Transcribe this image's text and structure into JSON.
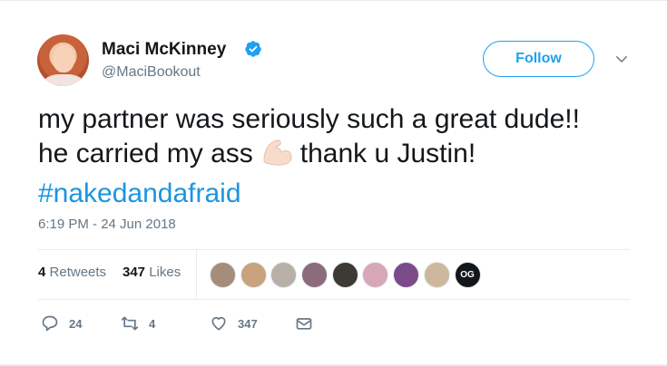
{
  "user": {
    "name": "Maci McKinney",
    "handle": "@MaciBookout",
    "verified": true
  },
  "follow_label": "Follow",
  "tweet": {
    "text_line1": "my partner was seriously such a great dude!!",
    "text_line2_before": "he carried my ass",
    "emoji": "flexed-biceps-emoji",
    "text_line2_after": "thank u Justin!",
    "hashtag": "#nakedandafraid"
  },
  "timestamp": "6:19 PM - 24 Jun 2018",
  "stats": {
    "retweets_count": "4",
    "retweets_label": "Retweets",
    "likes_count": "347",
    "likes_label": "Likes"
  },
  "likers": [
    {
      "color": "#a68d7a"
    },
    {
      "color": "#c9a27e"
    },
    {
      "color": "#b8b0a6"
    },
    {
      "color": "#8c6b7a"
    },
    {
      "color": "#3d3a36"
    },
    {
      "color": "#d7a7b7"
    },
    {
      "color": "#7b4b8a"
    },
    {
      "color": "#cdb89d"
    },
    {
      "color": "#14171a",
      "label": "OG"
    }
  ],
  "actions": {
    "replies": "24",
    "retweets": "4",
    "likes": "347"
  },
  "colors": {
    "accent": "#1da1f2",
    "hashtag": "#1b95e0",
    "muted": "#657786",
    "text": "#14171a"
  }
}
